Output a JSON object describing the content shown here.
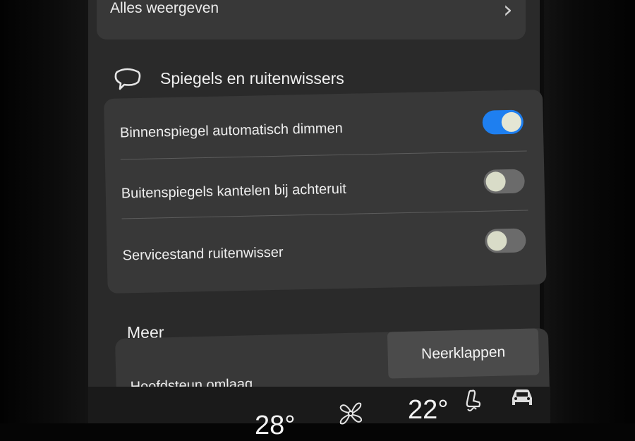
{
  "previous_section": {
    "show_all_label": "Alles weergeven"
  },
  "mirrors_section": {
    "title": "Spiegels en ruitenwissers",
    "icon": "mirror-icon",
    "items": [
      {
        "label": "Binnenspiegel automatisch dimmen",
        "enabled": true
      },
      {
        "label": "Buitenspiegels kantelen bij achteruit",
        "enabled": false
      },
      {
        "label": "Servicestand ruitenwisser",
        "enabled": false
      }
    ]
  },
  "more_section": {
    "title": "Meer",
    "headrest_label": "Hoofdsteun omlaag",
    "fold_button_label": "Neerklappen"
  },
  "climate_bar": {
    "left_temp": "28°",
    "right_temp": "22°",
    "fan_icon": "fan-icon",
    "seat_icon": "seat-heat-icon",
    "car_icon": "car-icon"
  },
  "colors": {
    "toggle_on": "#1e7ff0",
    "toggle_off": "#6b6b6b",
    "card": "#383838",
    "screen_bg": "#2a2a2a"
  }
}
